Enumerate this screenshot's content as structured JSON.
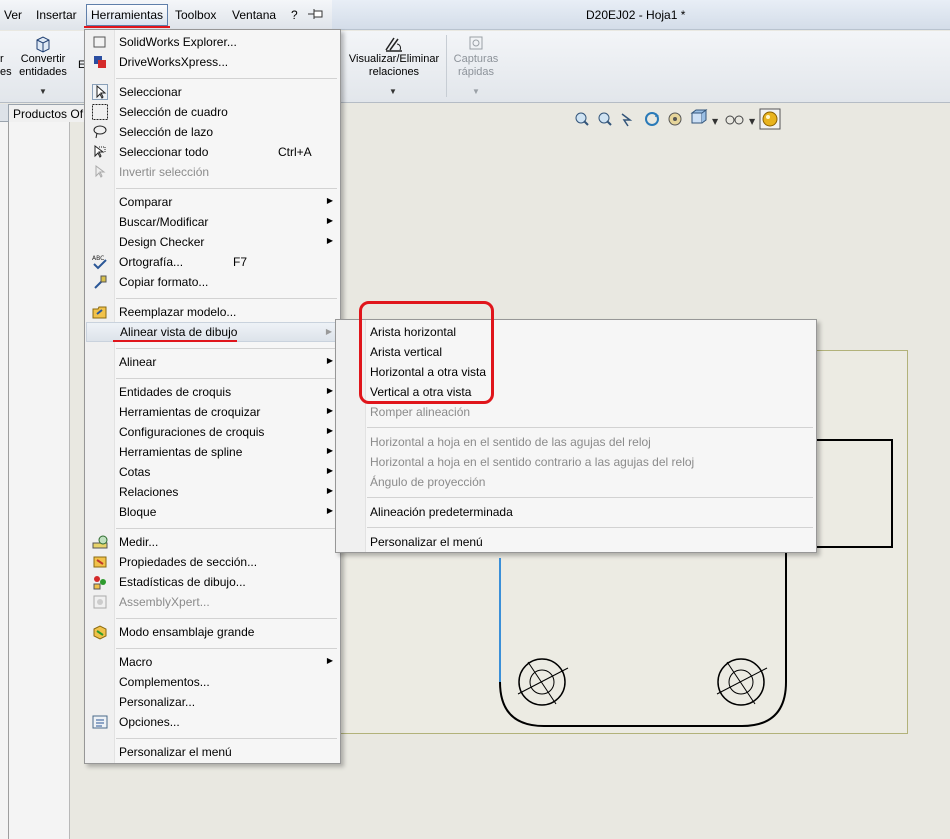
{
  "menubar": {
    "items": [
      "Ver",
      "Insertar",
      "Herramientas",
      "Toolbox",
      "Ventana",
      "?"
    ],
    "doc_title": "D20EJ02 - Hoja1 *"
  },
  "ribbon": {
    "partial_left": "r\nes",
    "convertir": "Convertir\nentidades",
    "partial_e": "E",
    "visualizar": "Visualizar/Eliminar\nrelaciones",
    "capturas": "Capturas\nrápidas"
  },
  "left_tab": {
    "label": "Productos Of"
  },
  "tools_menu": {
    "items": [
      {
        "label": "SolidWorks Explorer...",
        "icon": "explorer-icon"
      },
      {
        "label": "DriveWorksXpress...",
        "icon": "driveworks-icon"
      },
      {
        "label": "Seleccionar",
        "icon": "select-arrow-icon"
      },
      {
        "label": "Selección de cuadro",
        "icon": "box-select-icon"
      },
      {
        "label": "Selección de lazo",
        "icon": "lasso-select-icon"
      },
      {
        "label": "Seleccionar todo",
        "icon": "select-all-icon",
        "shortcut": "Ctrl+A"
      },
      {
        "label": "Invertir selección",
        "icon": "invert-select-icon",
        "disabled": true
      },
      {
        "label": "Comparar",
        "submenu": true
      },
      {
        "label": "Buscar/Modificar",
        "submenu": true
      },
      {
        "label": "Design Checker",
        "submenu": true
      },
      {
        "label": "Ortografía...",
        "icon": "spelling-icon",
        "shortcut": "F7"
      },
      {
        "label": "Copiar formato...",
        "icon": "format-painter-icon"
      },
      {
        "label": "Reemplazar modelo...",
        "icon": "replace-model-icon"
      },
      {
        "label": "Alinear vista de dibujo",
        "submenu": true,
        "highlighted": true
      },
      {
        "label": "Alinear",
        "submenu": true
      },
      {
        "label": "Entidades de croquis",
        "submenu": true
      },
      {
        "label": "Herramientas de croquizar",
        "submenu": true
      },
      {
        "label": "Configuraciones de croquis",
        "submenu": true
      },
      {
        "label": "Herramientas de spline",
        "submenu": true
      },
      {
        "label": "Cotas",
        "submenu": true
      },
      {
        "label": "Relaciones",
        "submenu": true
      },
      {
        "label": "Bloque",
        "submenu": true
      },
      {
        "label": "Medir...",
        "icon": "measure-icon"
      },
      {
        "label": "Propiedades de sección...",
        "icon": "section-properties-icon"
      },
      {
        "label": "Estadísticas de dibujo...",
        "icon": "drawing-stats-icon"
      },
      {
        "label": "AssemblyXpert...",
        "icon": "assemblyxpert-icon",
        "disabled": true
      },
      {
        "label": "Modo ensamblaje grande",
        "icon": "large-assembly-icon"
      },
      {
        "label": "Macro",
        "submenu": true
      },
      {
        "label": "Complementos..."
      },
      {
        "label": "Personalizar..."
      },
      {
        "label": "Opciones...",
        "icon": "options-icon"
      },
      {
        "label": "Personalizar el menú"
      }
    ]
  },
  "align_submenu": {
    "items": [
      {
        "label": "Arista horizontal"
      },
      {
        "label": "Arista vertical"
      },
      {
        "label": "Horizontal a otra vista"
      },
      {
        "label": "Vertical a otra vista"
      },
      {
        "label": "Romper alineación",
        "disabled": true
      },
      {
        "label": "Horizontal a hoja en el sentido de las agujas del reloj",
        "disabled": true
      },
      {
        "label": "Horizontal a hoja en el sentido contrario a las agujas del reloj",
        "disabled": true
      },
      {
        "label": "Ángulo de proyección",
        "disabled": true
      },
      {
        "label": "Alineación predeterminada"
      },
      {
        "label": "Personalizar el menú"
      }
    ]
  },
  "colors": {
    "highlight_red": "#e0151b",
    "model_edge_blue": "#3a8fd8"
  }
}
